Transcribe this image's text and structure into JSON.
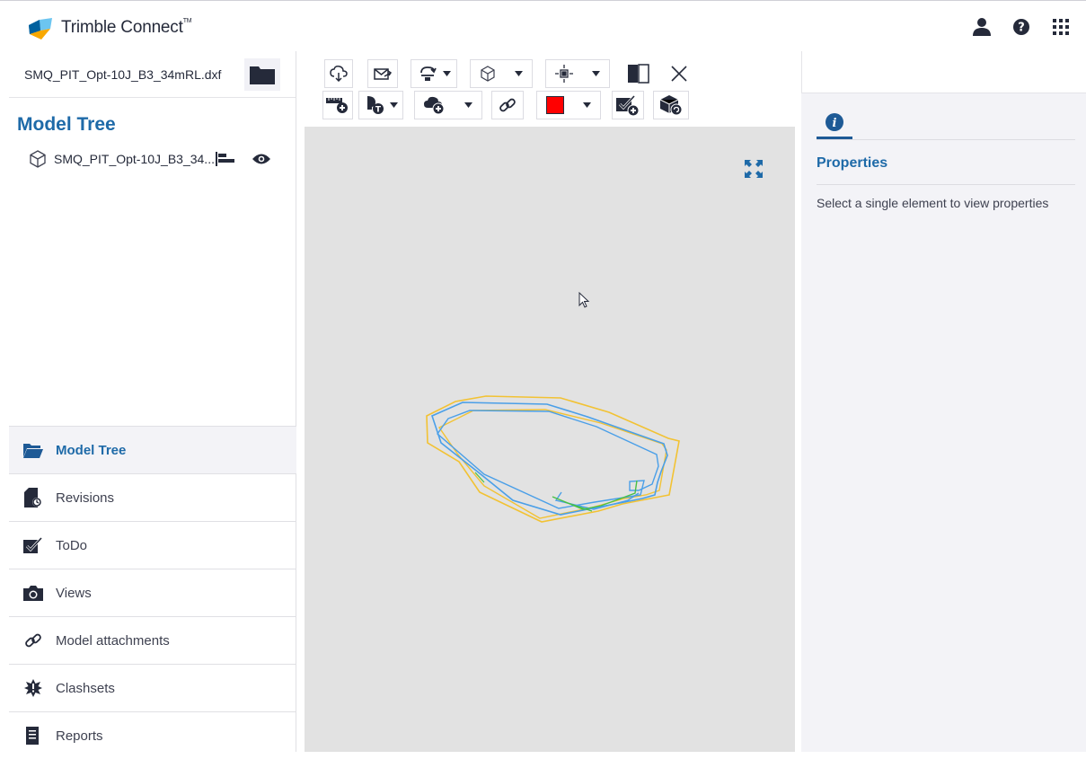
{
  "app": {
    "brand": "Trimble Connect",
    "brand_mark": "TM",
    "brand_color": "#0063a3",
    "accent_color": "#1e6aa8"
  },
  "header": {
    "icons": [
      "user-icon",
      "help-icon",
      "apps-grid-icon"
    ]
  },
  "left_panel": {
    "file_name": "SMQ_PIT_Opt-10J_B3_34mRL.dxf",
    "tree_title": "Model Tree",
    "tree_item": "SMQ_PIT_Opt-10J_B3_34...",
    "nav": [
      {
        "label": "Model Tree",
        "icon": "folder-icon",
        "active": true
      },
      {
        "label": "Revisions",
        "icon": "revisions-icon",
        "active": false
      },
      {
        "label": "ToDo",
        "icon": "todo-icon",
        "active": false
      },
      {
        "label": "Views",
        "icon": "camera-icon",
        "active": false
      },
      {
        "label": "Model attachments",
        "icon": "link-icon",
        "active": false
      },
      {
        "label": "Clashsets",
        "icon": "clash-icon",
        "active": false
      },
      {
        "label": "Reports",
        "icon": "report-icon",
        "active": false
      }
    ]
  },
  "toolbar": {
    "row1": [
      "cloud-icon",
      "share-icon",
      "rotate-icon",
      "cube-icon",
      "fit-icon",
      "section-icon",
      "close-icon"
    ],
    "row2": [
      "measure-icon",
      "markup-icon",
      "cloud-add-icon",
      "link-icon",
      "color-swatch",
      "todo-add-icon",
      "model-icon"
    ],
    "swatch_color": "#ff0000"
  },
  "right_panel": {
    "tab_icon": "info-icon",
    "title": "Properties",
    "message": "Select a single element to view properties"
  }
}
